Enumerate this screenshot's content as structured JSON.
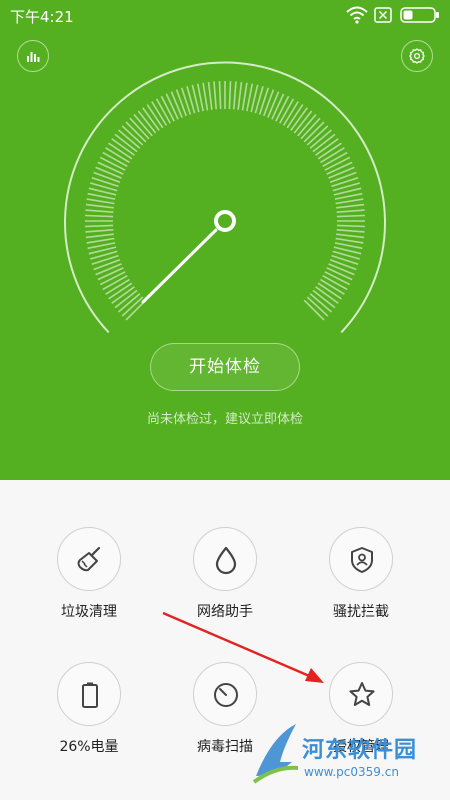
{
  "status_bar": {
    "time": "下午4:21",
    "icons": [
      "wifi-icon",
      "sim-disabled-icon",
      "battery-icon"
    ]
  },
  "header": {
    "stats_icon": "bar-chart-icon",
    "settings_icon": "gear-icon"
  },
  "checkup": {
    "button_label": "开始体检",
    "hint": "尚未体检过，建议立即体检",
    "accent_color": "#55b021"
  },
  "tools": [
    {
      "label": "垃圾清理",
      "icon": "broom-icon"
    },
    {
      "label": "网络助手",
      "icon": "drop-icon"
    },
    {
      "label": "骚扰拦截",
      "icon": "shield-user-icon"
    },
    {
      "label": "26%电量",
      "icon": "battery-icon"
    },
    {
      "label": "病毒扫描",
      "icon": "scan-icon"
    },
    {
      "label": "授权管理",
      "icon": "star-icon"
    }
  ],
  "watermark": {
    "title": "河东软件园",
    "url": "www.pc0359.cn"
  }
}
